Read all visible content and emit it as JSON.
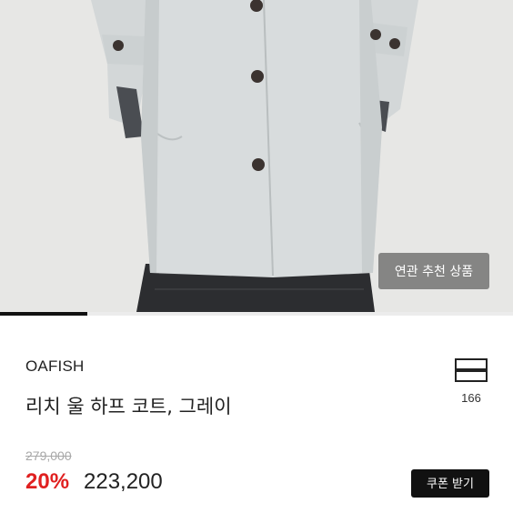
{
  "product": {
    "brand": "OAFISH",
    "title": "리치 울 하프 코트, 그레이",
    "original_price": "279,000",
    "discount_rate": "20%",
    "sale_price": "223,200",
    "wish_count": "166"
  },
  "gallery": {
    "related_button_label": "연관 추천 상품",
    "progress_fraction": 0.17,
    "image_description": "model wearing light gray wool half coat with dark buttons, hands in pockets"
  },
  "actions": {
    "coupon_label": "쿠폰 받기"
  },
  "colors": {
    "accent_discount": "#e02020",
    "button_dark": "#111111",
    "coat": "#d7dbdc"
  },
  "icons": {
    "wishlist": "hanger-icon"
  }
}
